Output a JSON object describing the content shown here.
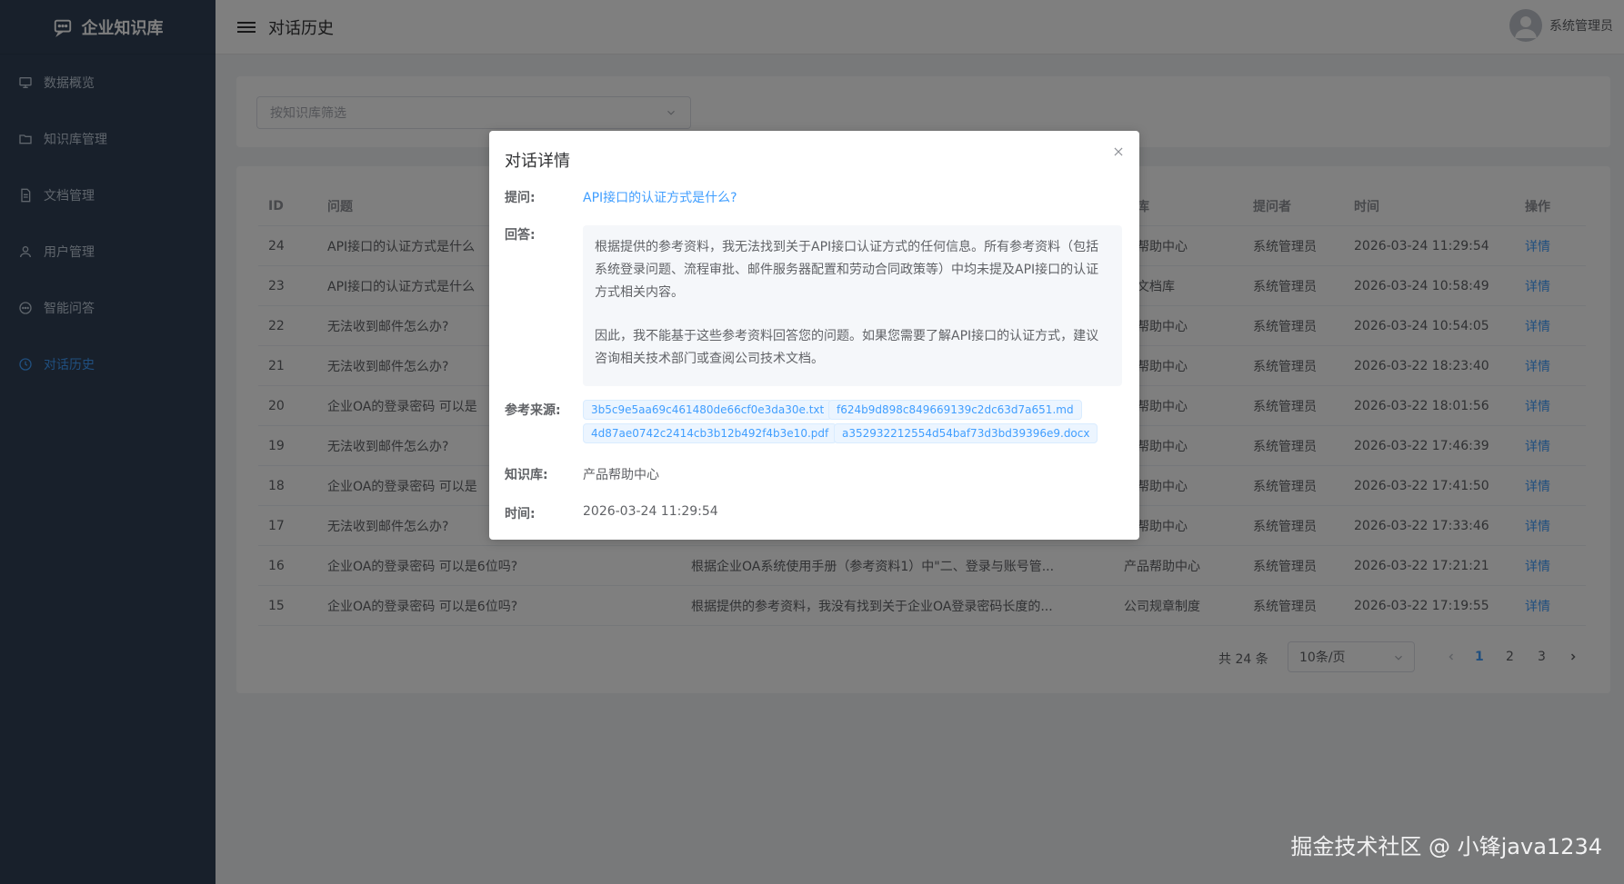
{
  "app": {
    "title": "企业知识库"
  },
  "sidebar": {
    "items": [
      {
        "label": "数据概览",
        "icon": "dashboard-icon"
      },
      {
        "label": "知识库管理",
        "icon": "folder-icon"
      },
      {
        "label": "文档管理",
        "icon": "document-icon"
      },
      {
        "label": "用户管理",
        "icon": "user-icon"
      },
      {
        "label": "智能问答",
        "icon": "chat-icon"
      },
      {
        "label": "对话历史",
        "icon": "clock-icon",
        "active": true
      }
    ]
  },
  "header": {
    "title": "对话历史",
    "user": "系统管理员"
  },
  "filter": {
    "placeholder": "按知识库筛选"
  },
  "table": {
    "columns": [
      "ID",
      "问题",
      "识库",
      "提问者",
      "时间",
      "操作"
    ],
    "rows": [
      {
        "id": "24",
        "question": "API接口的认证方式是什么",
        "answer": "",
        "kb": "品帮助中心",
        "user": "系统管理员",
        "time": "2026-03-24 11:29:54",
        "op": "详情"
      },
      {
        "id": "23",
        "question": "API接口的认证方式是什么",
        "answer": "",
        "kb": "术文档库",
        "user": "系统管理员",
        "time": "2026-03-24 10:58:49",
        "op": "详情"
      },
      {
        "id": "22",
        "question": "无法收到邮件怎么办?",
        "answer": "",
        "kb": "品帮助中心",
        "user": "系统管理员",
        "time": "2026-03-24 10:54:05",
        "op": "详情"
      },
      {
        "id": "21",
        "question": "无法收到邮件怎么办?",
        "answer": "",
        "kb": "品帮助中心",
        "user": "系统管理员",
        "time": "2026-03-22 18:23:40",
        "op": "详情"
      },
      {
        "id": "20",
        "question": "企业OA的登录密码 可以是",
        "answer": "",
        "kb": "品帮助中心",
        "user": "系统管理员",
        "time": "2026-03-22 18:01:56",
        "op": "详情"
      },
      {
        "id": "19",
        "question": "无法收到邮件怎么办?",
        "answer": "",
        "kb": "品帮助中心",
        "user": "系统管理员",
        "time": "2026-03-22 17:46:39",
        "op": "详情"
      },
      {
        "id": "18",
        "question": "企业OA的登录密码 可以是",
        "answer": "",
        "kb": "品帮助中心",
        "user": "系统管理员",
        "time": "2026-03-22 17:41:50",
        "op": "详情"
      },
      {
        "id": "17",
        "question": "无法收到邮件怎么办?",
        "answer": "",
        "kb": "品帮助中心",
        "user": "系统管理员",
        "time": "2026-03-22 17:33:46",
        "op": "详情"
      },
      {
        "id": "16",
        "question": "企业OA的登录密码 可以是6位吗?",
        "answer": "根据企业OA系统使用手册（参考资料1）中\"二、登录与账号管...",
        "kb": "产品帮助中心",
        "user": "系统管理员",
        "time": "2026-03-22 17:21:21",
        "op": "详情"
      },
      {
        "id": "15",
        "question": "企业OA的登录密码 可以是6位吗?",
        "answer": "根据提供的参考资料，我没有找到关于企业OA登录密码长度的...",
        "kb": "公司规章制度",
        "user": "系统管理员",
        "time": "2026-03-22 17:19:55",
        "op": "详情"
      }
    ]
  },
  "pagination": {
    "total": "共 24 条",
    "page_size": "10条/页",
    "pages": [
      "1",
      "2",
      "3"
    ],
    "current": "1"
  },
  "dialog": {
    "title": "对话详情",
    "question_label": "提问:",
    "question": "API接口的认证方式是什么?",
    "answer_label": "回答:",
    "answer_p1": "根据提供的参考资料，我无法找到关于API接口认证方式的任何信息。所有参考资料（包括系统登录问题、流程审批、邮件服务器配置和劳动合同政策等）中均未提及API接口的认证方式相关内容。",
    "answer_p2": "因此，我不能基于这些参考资料回答您的问题。如果您需要了解API接口的认证方式，建议咨询相关技术部门或查阅公司技术文档。",
    "sources_label": "参考来源:",
    "sources": [
      "3b5c9e5aa69c461480de66cf0e3da30e.txt",
      "f624b9d898c849669139c2dc63d7a651.md",
      "4d87ae0742c2414cb3b12b492f4b3e10.pdf",
      "a352932212554d54baf73d3bd39396e9.docx"
    ],
    "kb_label": "知识库:",
    "kb": "产品帮助中心",
    "time_label": "时间:",
    "time": "2026-03-24 11:29:54"
  },
  "watermark": "掘金技术社区 @ 小锋java1234"
}
